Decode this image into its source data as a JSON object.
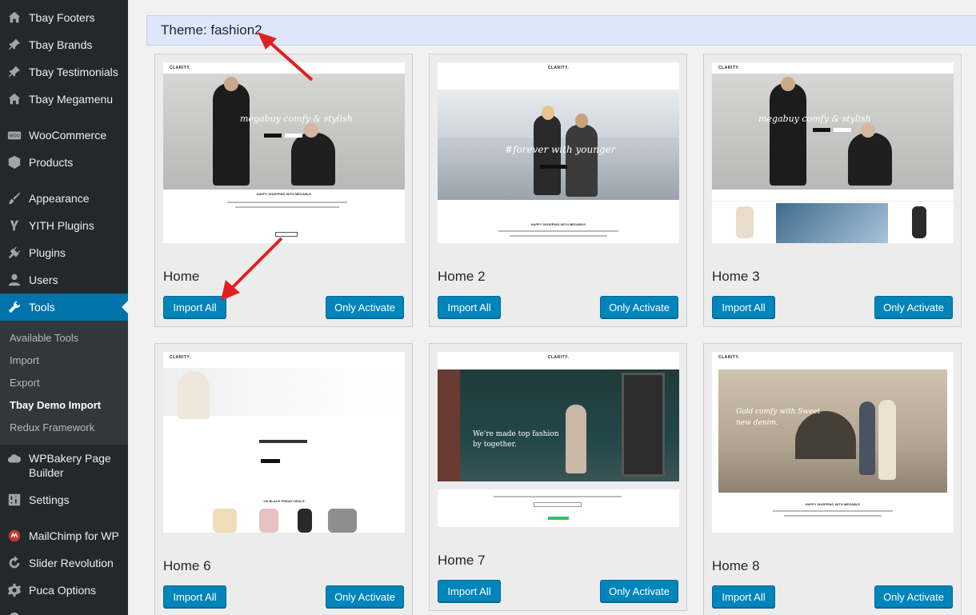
{
  "sidebar": {
    "items": [
      {
        "label": "Tbay Footers",
        "icon": "house-icon"
      },
      {
        "label": "Tbay Brands",
        "icon": "pin-icon"
      },
      {
        "label": "Tbay Testimonials",
        "icon": "pin-icon"
      },
      {
        "label": "Tbay Megamenu",
        "icon": "house-icon"
      },
      {
        "label": "WooCommerce",
        "icon": "woo-icon"
      },
      {
        "label": "Products",
        "icon": "cube-icon"
      },
      {
        "label": "Appearance",
        "icon": "brush-icon"
      },
      {
        "label": "YITH Plugins",
        "icon": "yith-icon"
      },
      {
        "label": "Plugins",
        "icon": "plug-icon"
      },
      {
        "label": "Users",
        "icon": "user-icon"
      },
      {
        "label": "Tools",
        "icon": "wrench-icon"
      },
      {
        "label": "WPBakery Page Builder",
        "icon": "cloud-icon"
      },
      {
        "label": "Settings",
        "icon": "sliders-icon"
      },
      {
        "label": "MailChimp for WP",
        "icon": "mailchimp-icon"
      },
      {
        "label": "Slider Revolution",
        "icon": "refresh-icon"
      },
      {
        "label": "Puca Options",
        "icon": "gear-icon"
      }
    ],
    "submenu": [
      "Available Tools",
      "Import",
      "Export",
      "Tbay Demo Import",
      "Redux Framework"
    ],
    "active_item": "Tools",
    "current_submenu": "Tbay Demo Import"
  },
  "theme_bar": {
    "label": "Theme: fashion2"
  },
  "demos": [
    {
      "title": "Home",
      "import_label": "Import All",
      "activate_label": "Only Activate"
    },
    {
      "title": "Home 2",
      "import_label": "Import All",
      "activate_label": "Only Activate"
    },
    {
      "title": "Home 3",
      "import_label": "Import All",
      "activate_label": "Only Activate"
    },
    {
      "title": "Home 6",
      "import_label": "Import All",
      "activate_label": "Only Activate"
    },
    {
      "title": "Home 7",
      "import_label": "Import All",
      "activate_label": "Only Activate"
    },
    {
      "title": "Home 8",
      "import_label": "Import All",
      "activate_label": "Only Activate"
    }
  ],
  "thumbs": {
    "logo": "CLARITY.",
    "home_tagline": "megabuy comfy & stylish",
    "home2_tagline": "#forever with younger",
    "home3_tagline": "megabuy comfy & stylish",
    "home7_tagline_a": "We're made top fashion",
    "home7_tagline_b": "by together.",
    "home8_tagline_a": "Gold comfy with Sweet",
    "home8_tagline_b": "new denim.",
    "happy_shopping": "HAPPY SHOPPING WITH MEGABUY",
    "black_friday": "ON BLACK FRIDAY DEALS"
  },
  "colors": {
    "sidebar": "#23282d",
    "active": "#0073aa",
    "button": "#0085ba",
    "annotation_arrow": "#e02020"
  }
}
